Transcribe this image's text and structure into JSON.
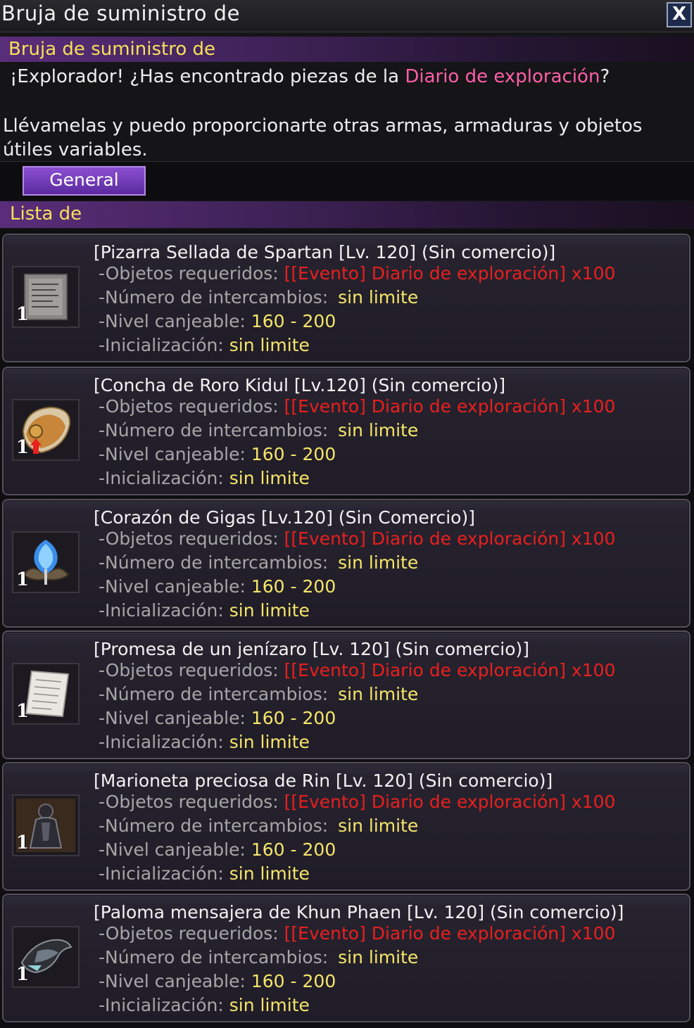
{
  "window": {
    "title": "Bruja de suministro de",
    "close_label": "X"
  },
  "npc": {
    "name": "Bruja de suministro de",
    "greeting_part1": "¡Explorador! ¿Has encontrado piezas de la ",
    "greeting_highlight": "Diario de exploración",
    "greeting_part2": "?",
    "message": "Llévamelas y puedo proporcionarte otras armas, armaduras y objetos útiles variables."
  },
  "tabs": {
    "general_label": "General"
  },
  "list": {
    "header": "Lista de",
    "labels": {
      "required": "-Objetos requeridos:",
      "exchanges": "-Número de intercambios:",
      "level": "-Nivel canjeable:",
      "reset": "-Inicialización:"
    },
    "items": [
      {
        "name": "[Pizarra Sellada de Spartan [Lv. 120] (Sin comercio)]",
        "required": "[[Evento] Diario de exploración] x100",
        "exchanges": "sin limite",
        "level": "160 - 200",
        "reset": "sin limite",
        "qty": "1",
        "icon": "slate-icon"
      },
      {
        "name": "[Concha de Roro Kidul [Lv.120] (Sin comercio)]",
        "required": "[[Evento] Diario de exploración] x100",
        "exchanges": "sin limite",
        "level": "160 - 200",
        "reset": "sin limite",
        "qty": "1",
        "icon": "shell-icon"
      },
      {
        "name": "[Corazón de Gigas [Lv.120] (Sin Comercio)]",
        "required": "[[Evento] Diario de exploración] x100",
        "exchanges": "sin limite",
        "level": "160 - 200",
        "reset": "sin limite",
        "qty": "1",
        "icon": "heart-crystal-icon"
      },
      {
        "name": "[Promesa de un jenízaro [Lv. 120] (Sin comercio)]",
        "required": "[[Evento] Diario de exploración] x100",
        "exchanges": "sin limite",
        "level": "160 - 200",
        "reset": "sin limite",
        "qty": "1",
        "icon": "scroll-icon"
      },
      {
        "name": "[Marioneta preciosa de Rin [Lv. 120] (Sin comercio)]",
        "required": "[[Evento] Diario de exploración] x100",
        "exchanges": "sin limite",
        "level": "160 - 200",
        "reset": "sin limite",
        "qty": "1",
        "icon": "puppet-icon"
      },
      {
        "name": "[Paloma mensajera de Khun Phaen [Lv. 120] (Sin comercio)]",
        "required": "[[Evento] Diario de exploración] x100",
        "exchanges": "sin limite",
        "level": "160 - 200",
        "reset": "sin limite",
        "qty": "1",
        "icon": "pigeon-icon"
      }
    ]
  }
}
